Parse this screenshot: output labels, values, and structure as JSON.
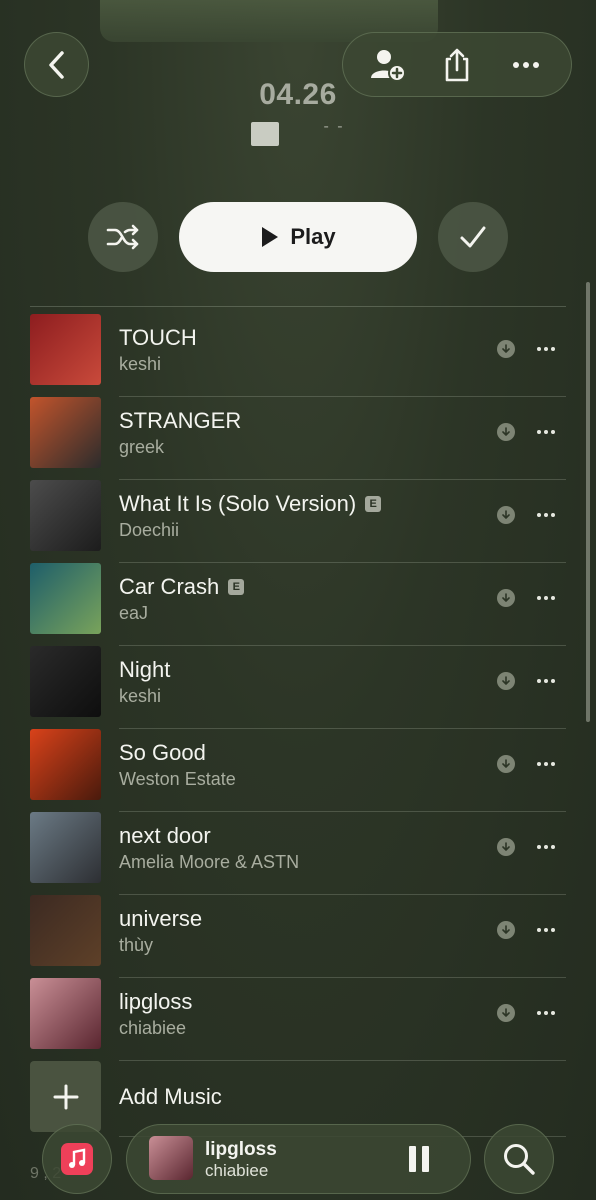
{
  "header": {
    "title": "04.26",
    "subtitle_trailing": "- -",
    "back_icon": "chevron-left-icon",
    "actions": [
      "add-person-icon",
      "share-icon",
      "more-horizontal-icon"
    ]
  },
  "controls": {
    "play_label": "Play",
    "shuffle_icon": "shuffle-icon",
    "check_icon": "checkmark-icon"
  },
  "songs": [
    {
      "title": "TOUCH",
      "artist": "keshi",
      "explicit": false,
      "art": [
        "#8d1d1f",
        "#c94a3b"
      ]
    },
    {
      "title": "STRANGER",
      "artist": "greek",
      "explicit": false,
      "art": [
        "#c2542c",
        "#2c2c2c"
      ]
    },
    {
      "title": "What It Is (Solo Version)",
      "artist": "Doechii",
      "explicit": true,
      "explicit_label": "E",
      "art": [
        "#4c4c4c",
        "#1c1c1c"
      ]
    },
    {
      "title": "Car Crash",
      "artist": "eaJ",
      "explicit": true,
      "explicit_label": "E",
      "art": [
        "#1e5e6a",
        "#79a35b"
      ]
    },
    {
      "title": "Night",
      "artist": "keshi",
      "explicit": false,
      "art": [
        "#2a2a2a",
        "#0e0e0e"
      ]
    },
    {
      "title": "So Good",
      "artist": "Weston Estate",
      "explicit": false,
      "art": [
        "#d9421a",
        "#4a1a0c"
      ]
    },
    {
      "title": "next door",
      "artist": "Amelia Moore & ASTN",
      "explicit": false,
      "art": [
        "#6b7a85",
        "#2d2f33"
      ]
    },
    {
      "title": "universe",
      "artist": "thùy",
      "explicit": false,
      "art": [
        "#3c2a22",
        "#5e4028"
      ]
    },
    {
      "title": "lipgloss",
      "artist": "chiabiee",
      "explicit": false,
      "art": [
        "#c98f96",
        "#5a2630"
      ]
    }
  ],
  "add_music": {
    "label": "Add Music",
    "icon": "plus-icon"
  },
  "footer": {
    "text": "9 , 2"
  },
  "mini_player": {
    "title": "lipgloss",
    "artist": "chiabiee",
    "library_icon": "music-note-icon",
    "pause_icon": "pause-icon",
    "search_icon": "search-icon"
  },
  "colors": {
    "background": "#2c3526",
    "library_accent": "#ef4059",
    "play_button_bg": "#f6f6f3"
  }
}
